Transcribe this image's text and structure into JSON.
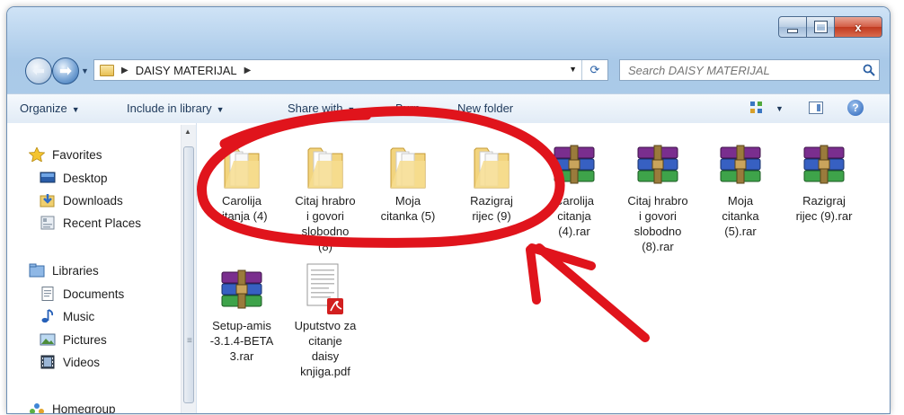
{
  "window": {
    "caption": {
      "minimize": "–",
      "maximize": "□",
      "close": "x"
    }
  },
  "address": {
    "folder": "DAISY MATERIJAL"
  },
  "search": {
    "placeholder": "Search DAISY MATERIJAL"
  },
  "toolbar": {
    "organize": "Organize",
    "include_in_library": "Include in library",
    "share_with": "Share with",
    "burn": "Burn",
    "new_folder": "New folder"
  },
  "sidebar": {
    "favorites": "Favorites",
    "desktop": "Desktop",
    "downloads": "Downloads",
    "recent_places": "Recent Places",
    "libraries": "Libraries",
    "documents": "Documents",
    "music": "Music",
    "pictures": "Pictures",
    "videos": "Videos",
    "homegroup": "Homegroup"
  },
  "files": [
    {
      "type": "folder",
      "lines": [
        "Carolija",
        "citanja (4)"
      ]
    },
    {
      "type": "folder",
      "lines": [
        "Citaj hrabro",
        "i govori",
        "slobodno",
        "(8)"
      ]
    },
    {
      "type": "folder",
      "lines": [
        "Moja",
        "citanka (5)"
      ]
    },
    {
      "type": "folder",
      "lines": [
        "Razigraj",
        "rijec (9)"
      ]
    },
    {
      "type": "rar",
      "lines": [
        "Carolija",
        "citanja",
        "(4).rar"
      ]
    },
    {
      "type": "rar",
      "lines": [
        "Citaj hrabro",
        "i govori",
        "slobodno",
        "(8).rar"
      ]
    },
    {
      "type": "rar",
      "lines": [
        "Moja",
        "citanka",
        "(5).rar"
      ]
    },
    {
      "type": "rar",
      "lines": [
        "Razigraj",
        "rijec (9).rar"
      ]
    },
    {
      "type": "rar",
      "lines": [
        "Setup-amis",
        "-3.1.4-BETA",
        "3.rar"
      ]
    },
    {
      "type": "pdf",
      "lines": [
        "Uputstvo za",
        "citanje",
        "daisy",
        "knjiga.pdf"
      ]
    }
  ],
  "colors": {
    "annotation": "#e0141c",
    "toolbar_text": "#1e395b"
  }
}
